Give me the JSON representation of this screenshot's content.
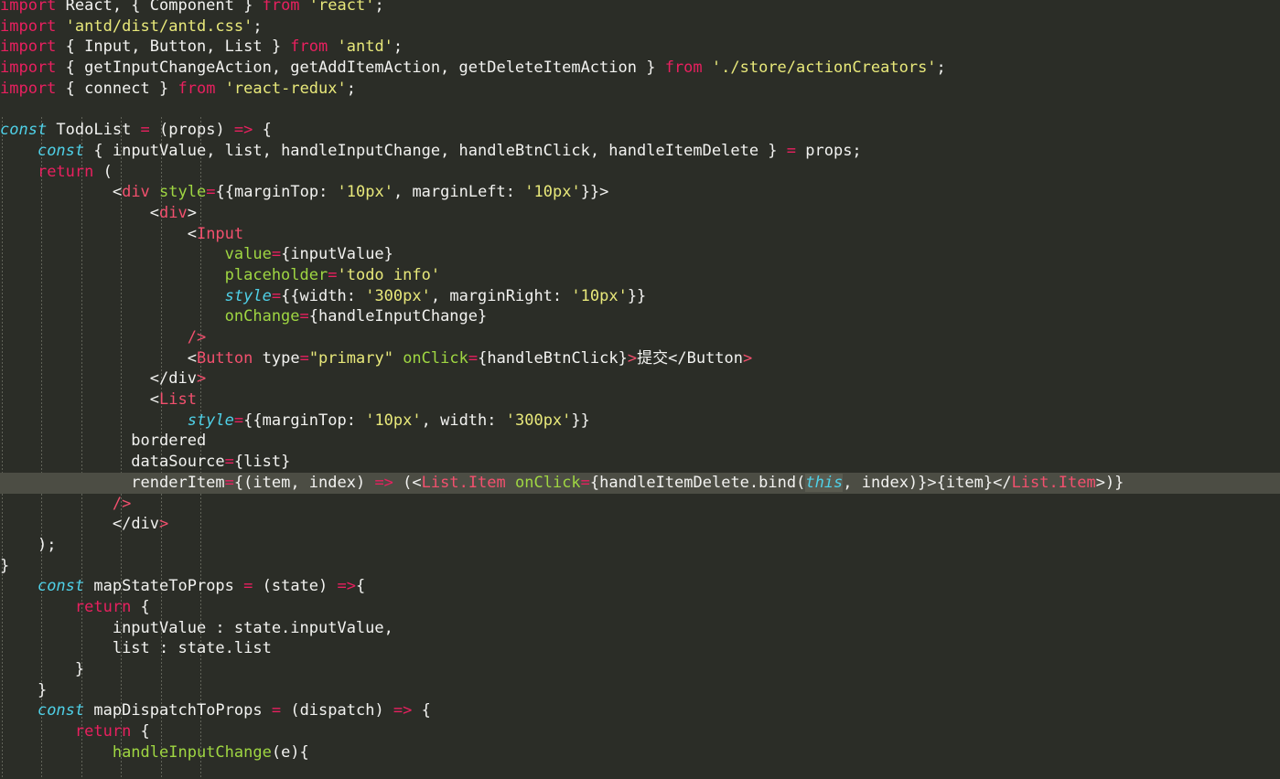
{
  "editor": {
    "app": "code-editor",
    "language": "javascript-react-jsx",
    "theme_colors": {
      "background": "#2b2d27",
      "current_line_highlight": "#4c4d44",
      "selection_highlight": "#5a5b50",
      "default_text": "#f2f2f0",
      "keyword": "#e8205f",
      "keyword_const": "#4fd0e7",
      "string": "#e8e87a",
      "attribute": "#9fd642",
      "jsx_tag": "#f2506e",
      "indent_guide": "#6a6c62"
    },
    "current_line_number": 24,
    "selected_token": "this",
    "indent_guide_columns": [
      0,
      4,
      8,
      12,
      16,
      20
    ]
  },
  "code": {
    "lines": [
      {
        "n": 1,
        "indent": 0,
        "tokens": [
          {
            "t": "import",
            "c": "kw"
          },
          {
            "t": " React, { Component } ",
            "c": "plain"
          },
          {
            "t": "from",
            "c": "kw"
          },
          {
            "t": " ",
            "c": "plain"
          },
          {
            "t": "'react'",
            "c": "str"
          },
          {
            "t": ";",
            "c": "plain"
          }
        ]
      },
      {
        "n": 2,
        "indent": 0,
        "tokens": [
          {
            "t": "import",
            "c": "kw"
          },
          {
            "t": " ",
            "c": "plain"
          },
          {
            "t": "'antd/dist/antd.css'",
            "c": "str"
          },
          {
            "t": ";",
            "c": "plain"
          }
        ]
      },
      {
        "n": 3,
        "indent": 0,
        "tokens": [
          {
            "t": "import",
            "c": "kw"
          },
          {
            "t": " { Input, Button, List } ",
            "c": "plain"
          },
          {
            "t": "from",
            "c": "kw"
          },
          {
            "t": " ",
            "c": "plain"
          },
          {
            "t": "'antd'",
            "c": "str"
          },
          {
            "t": ";",
            "c": "plain"
          }
        ]
      },
      {
        "n": 4,
        "indent": 0,
        "tokens": [
          {
            "t": "import",
            "c": "kw"
          },
          {
            "t": " { getInputChangeAction, getAddItemAction, getDeleteItemAction } ",
            "c": "plain"
          },
          {
            "t": "from",
            "c": "kw"
          },
          {
            "t": " ",
            "c": "plain"
          },
          {
            "t": "'./store/actionCreators'",
            "c": "str"
          },
          {
            "t": ";",
            "c": "plain"
          }
        ]
      },
      {
        "n": 5,
        "indent": 0,
        "tokens": [
          {
            "t": "import",
            "c": "kw"
          },
          {
            "t": " { connect } ",
            "c": "plain"
          },
          {
            "t": "from",
            "c": "kw"
          },
          {
            "t": " ",
            "c": "plain"
          },
          {
            "t": "'react-redux'",
            "c": "str"
          },
          {
            "t": ";",
            "c": "plain"
          }
        ]
      },
      {
        "n": 6,
        "indent": 0,
        "tokens": []
      },
      {
        "n": 7,
        "indent": 0,
        "tokens": [
          {
            "t": "const",
            "c": "kw2"
          },
          {
            "t": " TodoList ",
            "c": "plain"
          },
          {
            "t": "=",
            "c": "op"
          },
          {
            "t": " (props) ",
            "c": "plain"
          },
          {
            "t": "=>",
            "c": "op"
          },
          {
            "t": " {",
            "c": "plain"
          }
        ]
      },
      {
        "n": 8,
        "indent": 4,
        "tokens": [
          {
            "t": "const",
            "c": "kw2"
          },
          {
            "t": " { inputValue, list, handleInputChange, handleBtnClick, handleItemDelete } ",
            "c": "plain"
          },
          {
            "t": "=",
            "c": "op"
          },
          {
            "t": " props;",
            "c": "plain"
          }
        ]
      },
      {
        "n": 9,
        "indent": 4,
        "tokens": [
          {
            "t": "return",
            "c": "kw"
          },
          {
            "t": " (",
            "c": "plain"
          }
        ]
      },
      {
        "n": 10,
        "indent": 12,
        "tokens": [
          {
            "t": "<",
            "c": "plain"
          },
          {
            "t": "div",
            "c": "tag"
          },
          {
            "t": " ",
            "c": "plain"
          },
          {
            "t": "style",
            "c": "attr"
          },
          {
            "t": "=",
            "c": "op"
          },
          {
            "t": "{{marginTop: ",
            "c": "plain"
          },
          {
            "t": "'10px'",
            "c": "str"
          },
          {
            "t": ", marginLeft: ",
            "c": "plain"
          },
          {
            "t": "'10px'",
            "c": "str"
          },
          {
            "t": "}}",
            "c": "plain"
          },
          {
            "t": ">",
            "c": "plain"
          }
        ]
      },
      {
        "n": 11,
        "indent": 16,
        "tokens": [
          {
            "t": "<",
            "c": "plain"
          },
          {
            "t": "div",
            "c": "tag"
          },
          {
            "t": ">",
            "c": "plain"
          }
        ]
      },
      {
        "n": 12,
        "indent": 20,
        "tokens": [
          {
            "t": "<",
            "c": "plain"
          },
          {
            "t": "Input",
            "c": "tag"
          }
        ]
      },
      {
        "n": 13,
        "indent": 24,
        "tokens": [
          {
            "t": "value",
            "c": "attr"
          },
          {
            "t": "=",
            "c": "op"
          },
          {
            "t": "{inputValue}",
            "c": "plain"
          }
        ]
      },
      {
        "n": 14,
        "indent": 24,
        "tokens": [
          {
            "t": "placeholder",
            "c": "attr"
          },
          {
            "t": "=",
            "c": "op"
          },
          {
            "t": "'todo info'",
            "c": "str"
          }
        ]
      },
      {
        "n": 15,
        "indent": 24,
        "tokens": [
          {
            "t": "style",
            "c": "kw2"
          },
          {
            "t": "=",
            "c": "op"
          },
          {
            "t": "{{width: ",
            "c": "plain"
          },
          {
            "t": "'300px'",
            "c": "str"
          },
          {
            "t": ", marginRight: ",
            "c": "plain"
          },
          {
            "t": "'10px'",
            "c": "str"
          },
          {
            "t": "}}",
            "c": "plain"
          }
        ]
      },
      {
        "n": 16,
        "indent": 24,
        "tokens": [
          {
            "t": "onChange",
            "c": "attr"
          },
          {
            "t": "=",
            "c": "op"
          },
          {
            "t": "{handleInputChange}",
            "c": "plain"
          }
        ]
      },
      {
        "n": 17,
        "indent": 20,
        "tokens": [
          {
            "t": "/>",
            "c": "tag"
          }
        ]
      },
      {
        "n": 18,
        "indent": 20,
        "tokens": [
          {
            "t": "<",
            "c": "plain"
          },
          {
            "t": "Button",
            "c": "tag"
          },
          {
            "t": " type",
            "c": "plain"
          },
          {
            "t": "=",
            "c": "op"
          },
          {
            "t": "\"primary\"",
            "c": "str"
          },
          {
            "t": " ",
            "c": "plain"
          },
          {
            "t": "onClick",
            "c": "attr"
          },
          {
            "t": "=",
            "c": "op"
          },
          {
            "t": "{handleBtnClick}",
            "c": "plain"
          },
          {
            "t": ">",
            "c": "tag"
          },
          {
            "t": "提交",
            "c": "cjk"
          },
          {
            "t": "</",
            "c": "plain"
          },
          {
            "t": "Button",
            "c": "plain"
          },
          {
            "t": ">",
            "c": "tag"
          }
        ]
      },
      {
        "n": 19,
        "indent": 16,
        "tokens": [
          {
            "t": "</",
            "c": "plain"
          },
          {
            "t": "div",
            "c": "plain"
          },
          {
            "t": ">",
            "c": "tag"
          }
        ]
      },
      {
        "n": 20,
        "indent": 16,
        "tokens": [
          {
            "t": "<",
            "c": "plain"
          },
          {
            "t": "List",
            "c": "tag"
          }
        ]
      },
      {
        "n": 21,
        "indent": 20,
        "tokens": [
          {
            "t": "style",
            "c": "kw2"
          },
          {
            "t": "=",
            "c": "op"
          },
          {
            "t": "{{marginTop: ",
            "c": "plain"
          },
          {
            "t": "'10px'",
            "c": "str"
          },
          {
            "t": ", width: ",
            "c": "plain"
          },
          {
            "t": "'300px'",
            "c": "str"
          },
          {
            "t": "}}",
            "c": "plain"
          }
        ]
      },
      {
        "n": 22,
        "indent": 14,
        "tokens": [
          {
            "t": "bordered",
            "c": "plain"
          }
        ]
      },
      {
        "n": 23,
        "indent": 14,
        "tokens": [
          {
            "t": "dataSource",
            "c": "plain"
          },
          {
            "t": "=",
            "c": "op"
          },
          {
            "t": "{list}",
            "c": "plain"
          }
        ]
      },
      {
        "n": 24,
        "indent": 14,
        "current": true,
        "tokens": [
          {
            "t": "renderItem",
            "c": "plain"
          },
          {
            "t": "=",
            "c": "op"
          },
          {
            "t": "{(item, index) ",
            "c": "plain"
          },
          {
            "t": "=>",
            "c": "op"
          },
          {
            "t": " (<",
            "c": "plain"
          },
          {
            "t": "List.Item",
            "c": "tag"
          },
          {
            "t": " ",
            "c": "plain"
          },
          {
            "t": "onClick",
            "c": "attr"
          },
          {
            "t": "=",
            "c": "op"
          },
          {
            "t": "{handleItemDelete.bind(",
            "c": "plain"
          },
          {
            "t": "this",
            "c": "sel"
          },
          {
            "t": ", index)}",
            "c": "plain"
          },
          {
            "t": ">",
            "c": "plain"
          },
          {
            "t": "{item}",
            "c": "plain"
          },
          {
            "t": "</",
            "c": "plain"
          },
          {
            "t": "List.Item",
            "c": "tag"
          },
          {
            "t": ">",
            "c": "plain"
          },
          {
            "t": ")}",
            "c": "plain"
          }
        ]
      },
      {
        "n": 25,
        "indent": 12,
        "tokens": [
          {
            "t": "/>",
            "c": "tag"
          }
        ]
      },
      {
        "n": 26,
        "indent": 12,
        "tokens": [
          {
            "t": "</",
            "c": "plain"
          },
          {
            "t": "div",
            "c": "plain"
          },
          {
            "t": ">",
            "c": "tag"
          }
        ]
      },
      {
        "n": 27,
        "indent": 4,
        "tokens": [
          {
            "t": ");",
            "c": "plain"
          }
        ]
      },
      {
        "n": 28,
        "indent": 0,
        "tokens": [
          {
            "t": "}",
            "c": "plain"
          }
        ]
      },
      {
        "n": 29,
        "indent": 4,
        "tokens": [
          {
            "t": "const",
            "c": "kw2"
          },
          {
            "t": " mapStateToProps ",
            "c": "plain"
          },
          {
            "t": "=",
            "c": "op"
          },
          {
            "t": " (state) ",
            "c": "plain"
          },
          {
            "t": "=>",
            "c": "op"
          },
          {
            "t": "{",
            "c": "plain"
          }
        ]
      },
      {
        "n": 30,
        "indent": 8,
        "tokens": [
          {
            "t": "return",
            "c": "kw"
          },
          {
            "t": " {",
            "c": "plain"
          }
        ]
      },
      {
        "n": 31,
        "indent": 12,
        "tokens": [
          {
            "t": "inputValue : state.inputValue,",
            "c": "plain"
          }
        ]
      },
      {
        "n": 32,
        "indent": 12,
        "tokens": [
          {
            "t": "list : state.list",
            "c": "plain"
          }
        ]
      },
      {
        "n": 33,
        "indent": 8,
        "tokens": [
          {
            "t": "}",
            "c": "plain"
          }
        ]
      },
      {
        "n": 34,
        "indent": 4,
        "tokens": [
          {
            "t": "}",
            "c": "plain"
          }
        ]
      },
      {
        "n": 35,
        "indent": 4,
        "tokens": [
          {
            "t": "const",
            "c": "kw2"
          },
          {
            "t": " mapDispatchToProps ",
            "c": "plain"
          },
          {
            "t": "=",
            "c": "op"
          },
          {
            "t": " (dispatch) ",
            "c": "plain"
          },
          {
            "t": "=>",
            "c": "op"
          },
          {
            "t": " {",
            "c": "plain"
          }
        ]
      },
      {
        "n": 36,
        "indent": 8,
        "tokens": [
          {
            "t": "return",
            "c": "kw"
          },
          {
            "t": " {",
            "c": "plain"
          }
        ]
      },
      {
        "n": 37,
        "indent": 12,
        "tokens": [
          {
            "t": "handleInputChange",
            "c": "attr"
          },
          {
            "t": "(e){",
            "c": "plain"
          }
        ]
      }
    ]
  }
}
